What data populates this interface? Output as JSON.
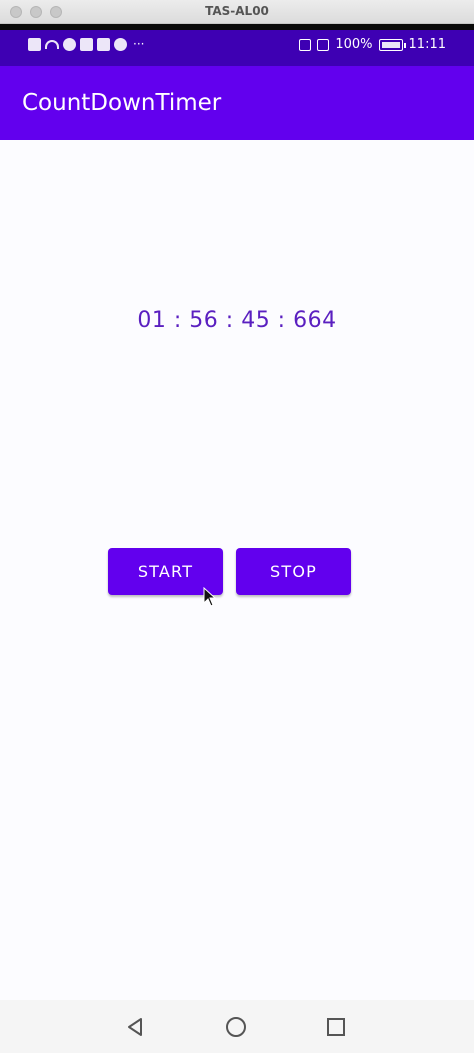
{
  "window": {
    "title": "TAS-AL00"
  },
  "status_bar": {
    "battery": "100%",
    "time": "11:11",
    "more": "···"
  },
  "app_bar": {
    "title": "CountDownTimer"
  },
  "timer": {
    "display": "01 : 56 : 45 : 664"
  },
  "buttons": {
    "start": "START",
    "stop": "STOP"
  },
  "colors": {
    "primary": "#6200ee",
    "status_bar": "#3e00b3",
    "timer_text": "#5a1fc0"
  },
  "icons": {
    "status_left": [
      "alert-icon",
      "wifi-icon",
      "app-icon",
      "app-icon",
      "app-icon",
      "app-icon"
    ],
    "status_right": [
      "nfc-icon",
      "mute-icon",
      "battery-icon"
    ],
    "nav": [
      "back-icon",
      "home-icon",
      "recents-icon"
    ]
  }
}
